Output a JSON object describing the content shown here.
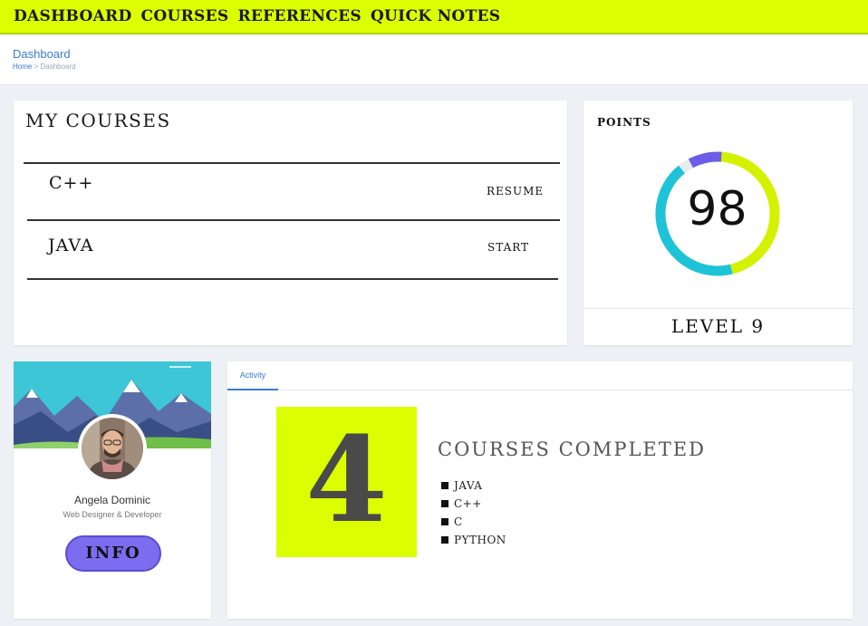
{
  "topnav": {
    "items": [
      "DASHBOARD",
      "COURSES",
      "REFERENCES",
      "QUICK NOTES"
    ]
  },
  "header": {
    "title": "Dashboard",
    "breadcrumb_home": "Home",
    "breadcrumb_sep": ">",
    "breadcrumb_current": "Dashboard"
  },
  "my_courses": {
    "heading": "MY COURSES",
    "items": [
      {
        "name": "C++",
        "action": "RESUME"
      },
      {
        "name": "JAVA",
        "action": "START"
      }
    ]
  },
  "points": {
    "label": "POINTS",
    "value": "98",
    "level": "LEVEL 9",
    "ring_fraction": 0.98,
    "colors": {
      "track": "#e9ecef",
      "lime": "#d4f200",
      "cyan": "#1fc3d8",
      "purple": "#6c5ce7"
    }
  },
  "profile": {
    "name": "Angela Dominic",
    "role": "Web Designer & Developer",
    "info_button": "INFO"
  },
  "activity": {
    "tab": "Activity",
    "count": "4",
    "completed_title": "COURSES COMPLETED",
    "courses": [
      "JAVA",
      "C++",
      "C",
      "PYTHON"
    ]
  },
  "colors": {
    "accent_lime": "#dcff00",
    "link_blue": "#3a7bd5",
    "info_purple": "#7b6cf0"
  }
}
